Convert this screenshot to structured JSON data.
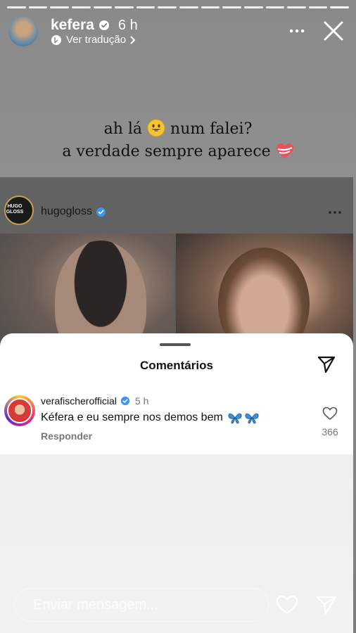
{
  "story": {
    "progress": {
      "segments": 16,
      "active_index": 15
    },
    "header": {
      "username": "kefera",
      "time": "6 h",
      "translate_label": "Ver tradução"
    },
    "caption": {
      "line1_a": "ah lá",
      "line1_b": "num falei?",
      "line2": "a verdade sempre aparece"
    },
    "post": {
      "username": "hugogloss",
      "avatar_text": "HUGO\nGLOSS"
    }
  },
  "comments": {
    "title": "Comentários",
    "items": [
      {
        "username": "verafischerofficial",
        "time": "5 h",
        "text": "Kéfera e eu sempre nos demos bem",
        "reply_label": "Responder",
        "likes": "366"
      }
    ]
  },
  "message_bar": {
    "placeholder": "Enviar mensagem..."
  },
  "colors": {
    "verified": "#3897f0",
    "butterfly": "#3e8fd6",
    "heart": "#e8505b"
  }
}
